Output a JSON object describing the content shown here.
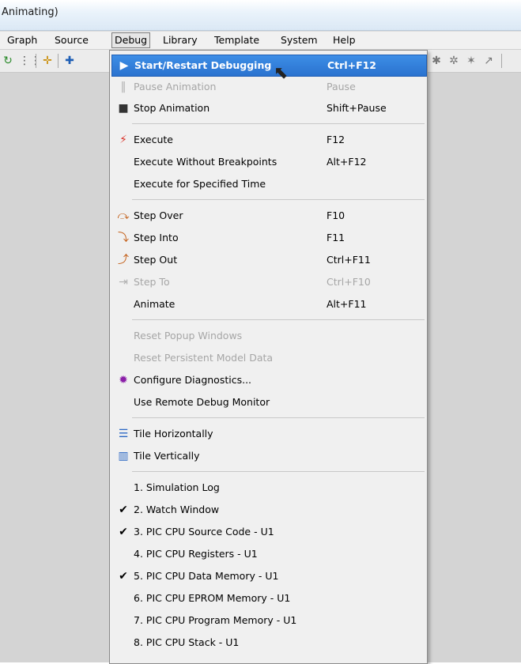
{
  "window": {
    "title": "Animating)"
  },
  "menubar": {
    "items": [
      "Graph",
      "Source",
      "Debug",
      "Library",
      "Template",
      "System",
      "Help"
    ],
    "active": "Debug"
  },
  "debug_menu": {
    "groups": [
      [
        {
          "label": "Start/Restart Debugging",
          "shortcut": "Ctrl+F12",
          "icon": "start-debug-icon",
          "state": "highlighted"
        },
        {
          "label": "Pause Animation",
          "shortcut": "Pause",
          "icon": "pause-icon",
          "state": "disabled"
        },
        {
          "label": "Stop Animation",
          "shortcut": "Shift+Pause",
          "icon": "stop-icon",
          "state": "normal"
        }
      ],
      [
        {
          "label": "Execute",
          "shortcut": "F12",
          "icon": "execute-icon",
          "state": "normal"
        },
        {
          "label": "Execute Without Breakpoints",
          "shortcut": "Alt+F12",
          "icon": "",
          "state": "normal"
        },
        {
          "label": "Execute for Specified Time",
          "shortcut": "",
          "icon": "",
          "state": "normal"
        }
      ],
      [
        {
          "label": "Step Over",
          "shortcut": "F10",
          "icon": "step-over-icon",
          "state": "normal"
        },
        {
          "label": "Step Into",
          "shortcut": "F11",
          "icon": "step-into-icon",
          "state": "normal"
        },
        {
          "label": "Step Out",
          "shortcut": "Ctrl+F11",
          "icon": "step-out-icon",
          "state": "normal"
        },
        {
          "label": "Step To",
          "shortcut": "Ctrl+F10",
          "icon": "step-to-icon",
          "state": "disabled"
        },
        {
          "label": "Animate",
          "shortcut": "Alt+F11",
          "icon": "",
          "state": "normal"
        }
      ],
      [
        {
          "label": "Reset Popup Windows",
          "shortcut": "",
          "icon": "",
          "state": "disabled"
        },
        {
          "label": "Reset Persistent Model Data",
          "shortcut": "",
          "icon": "",
          "state": "disabled"
        },
        {
          "label": "Configure Diagnostics...",
          "shortcut": "",
          "icon": "bug-icon",
          "state": "normal"
        },
        {
          "label": "Use Remote Debug Monitor",
          "shortcut": "",
          "icon": "",
          "state": "normal"
        }
      ],
      [
        {
          "label": "Tile Horizontally",
          "shortcut": "",
          "icon": "tile-horizontal-icon",
          "state": "normal"
        },
        {
          "label": "Tile Vertically",
          "shortcut": "",
          "icon": "tile-vertical-icon",
          "state": "normal"
        }
      ],
      [
        {
          "label": "1. Simulation Log",
          "shortcut": "",
          "icon": "",
          "state": "normal",
          "checked": false
        },
        {
          "label": "2. Watch Window",
          "shortcut": "",
          "icon": "",
          "state": "normal",
          "checked": true
        },
        {
          "label": "3. PIC CPU Source Code - U1",
          "shortcut": "",
          "icon": "",
          "state": "normal",
          "checked": true
        },
        {
          "label": "4. PIC CPU Registers - U1",
          "shortcut": "",
          "icon": "",
          "state": "normal",
          "checked": false
        },
        {
          "label": "5. PIC CPU Data Memory - U1",
          "shortcut": "",
          "icon": "",
          "state": "normal",
          "checked": true
        },
        {
          "label": "6. PIC CPU EPROM Memory - U1",
          "shortcut": "",
          "icon": "",
          "state": "normal",
          "checked": false
        },
        {
          "label": "7. PIC CPU Program Memory - U1",
          "shortcut": "",
          "icon": "",
          "state": "normal",
          "checked": false
        },
        {
          "label": "8. PIC CPU Stack - U1",
          "shortcut": "",
          "icon": "",
          "state": "normal",
          "checked": false
        }
      ]
    ]
  },
  "colors": {
    "highlight": "#2f7bd9",
    "disabled_text": "#a6a6a6",
    "execute_icon": "#d9342b",
    "bug_icon": "#8b1fa8",
    "tile_icon": "#2b67c4"
  }
}
